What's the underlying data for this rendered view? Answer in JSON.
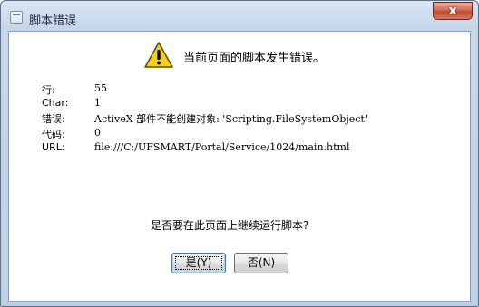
{
  "window": {
    "title": "脚本错误",
    "close_label": "x"
  },
  "dialog": {
    "headline": "当前页面的脚本发生错误。",
    "details": [
      {
        "label": "行:",
        "value": "55"
      },
      {
        "label": "Char:",
        "value": "1"
      },
      {
        "label": "错误:",
        "value": "ActiveX 部件不能创建对象: 'Scripting.FileSystemObject'"
      },
      {
        "label": "代码:",
        "value": "0"
      },
      {
        "label": "URL:",
        "value": "file:///C:/UFSMART/Portal/Service/1024/main.html"
      }
    ],
    "question": "是否要在此页面上继续运行脚本?",
    "yes_label": "是(Y)",
    "no_label": "否(N)"
  },
  "icons": {
    "app": "script-window-icon",
    "warning": "warning-icon",
    "close": "close-icon"
  },
  "colors": {
    "title_gradient_top": "#dbe6f3",
    "close_button": "#c04a30",
    "warning_yellow": "#f5d020"
  }
}
